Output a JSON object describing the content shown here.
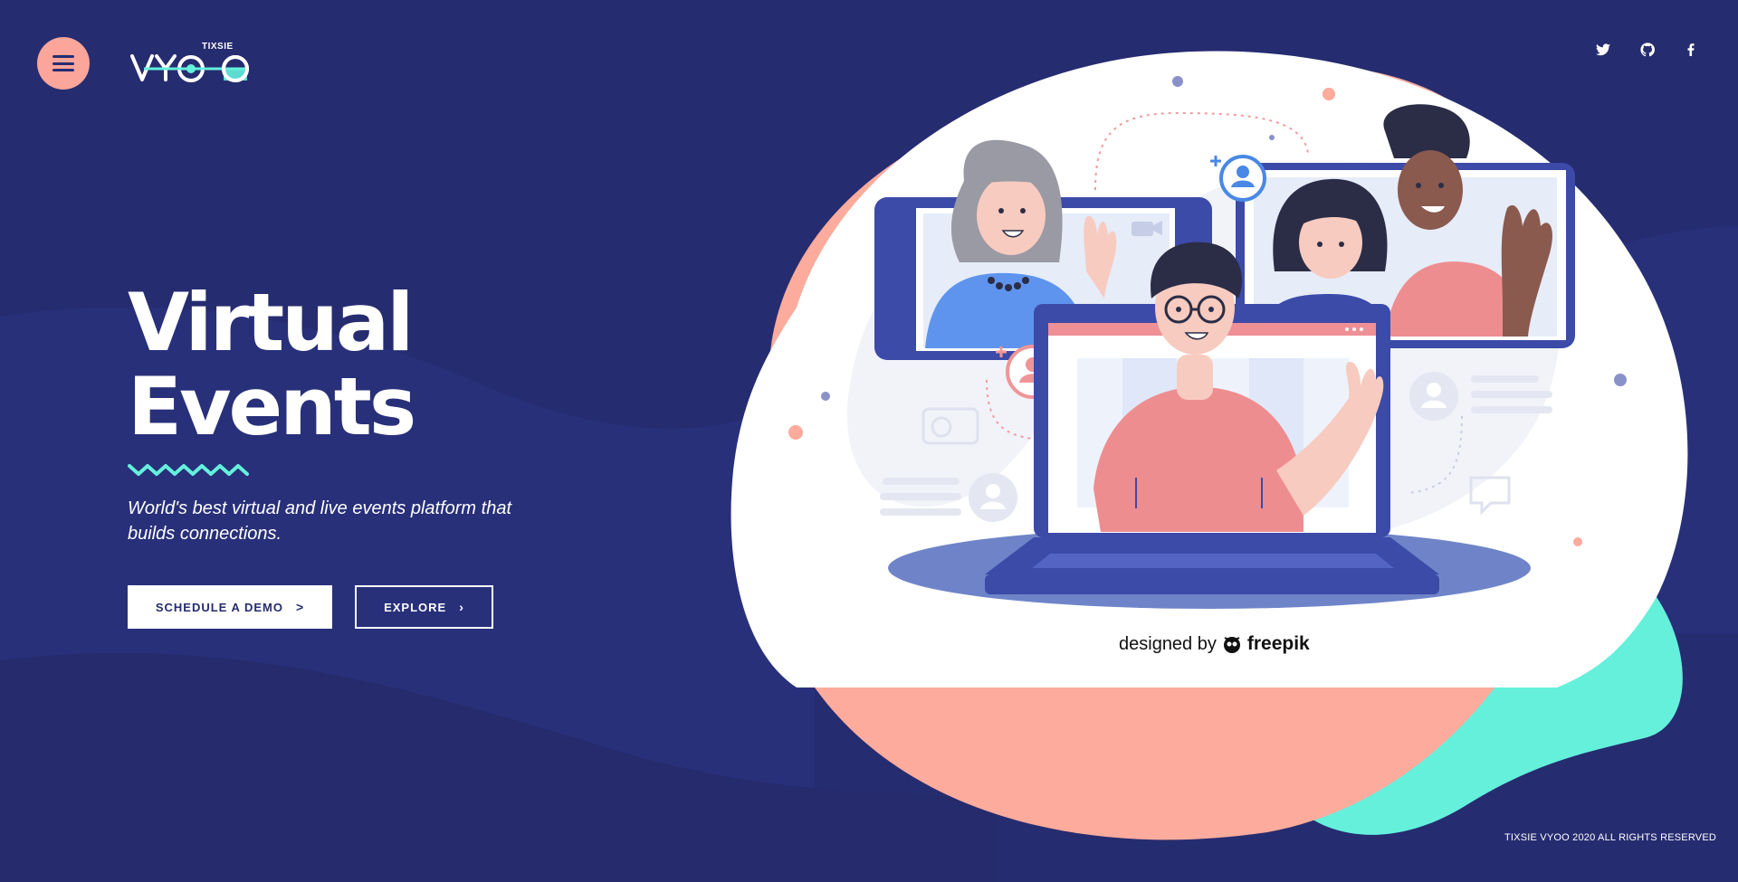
{
  "header": {
    "menu_icon": "hamburger-icon",
    "logo": {
      "tag": "TIXSIE",
      "wordmark": "VYOO"
    },
    "social": [
      {
        "icon": "twitter-icon",
        "label": "Twitter"
      },
      {
        "icon": "github-icon",
        "label": "GitHub"
      },
      {
        "icon": "facebook-icon",
        "label": "Facebook"
      }
    ]
  },
  "hero": {
    "title_line1": "Virtual",
    "title_line2": "Events",
    "tagline": "World's best virtual and live events platform that builds connections.",
    "buttons": {
      "primary": "SCHEDULE A DEMO",
      "secondary": "EXPLORE"
    }
  },
  "illustration": {
    "credit_prefix": "designed by",
    "credit_brand": "freepik"
  },
  "footer": {
    "copyright": "TIXSIE VYOO 2020 ALL RIGHTS RESERVED"
  },
  "colors": {
    "background": "#262c70",
    "accent_salmon": "#fca59a",
    "accent_mint": "#65f0dc",
    "white": "#ffffff"
  }
}
